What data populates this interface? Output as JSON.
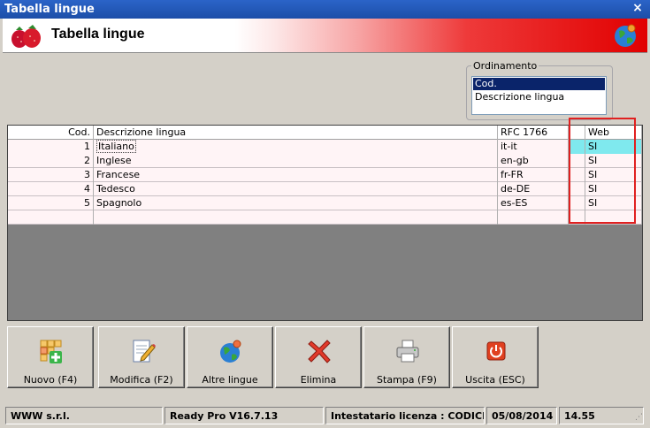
{
  "window": {
    "title": "Tabella lingue",
    "close_glyph": "×"
  },
  "header": {
    "title": "Tabella lingue",
    "logo_icon": "strawberry-icon",
    "globe_icon": "globe-icon"
  },
  "ordering": {
    "legend": "Ordinamento",
    "options": [
      "Cod.",
      "Descrizione lingua"
    ],
    "selected": "Cod."
  },
  "grid": {
    "columns": [
      "Cod.",
      "Descrizione lingua",
      "RFC 1766",
      "Web"
    ],
    "rows": [
      {
        "cod": "1",
        "desc": "Italiano",
        "rfc": "it-it",
        "web": "SI"
      },
      {
        "cod": "2",
        "desc": "Inglese",
        "rfc": "en-gb",
        "web": "SI"
      },
      {
        "cod": "3",
        "desc": "Francese",
        "rfc": "fr-FR",
        "web": "SI"
      },
      {
        "cod": "4",
        "desc": "Tedesco",
        "rfc": "de-DE",
        "web": "SI"
      },
      {
        "cod": "5",
        "desc": "Spagnolo",
        "rfc": "es-ES",
        "web": "SI"
      }
    ],
    "active_row_color": "#7fe9ee",
    "highlight_color": "#e02020"
  },
  "toolbar": {
    "buttons": [
      {
        "label": "Nuovo (F4)",
        "icon": "new-grid-icon"
      },
      {
        "label": "Modifica (F2)",
        "icon": "edit-document-icon"
      },
      {
        "label": "Altre lingue",
        "icon": "globe-icon"
      },
      {
        "label": "Elimina",
        "icon": "delete-x-icon"
      },
      {
        "label": "Stampa (F9)",
        "icon": "printer-icon"
      },
      {
        "label": "Uscita (ESC)",
        "icon": "exit-icon"
      }
    ]
  },
  "status": {
    "company": "WWW s.r.l.",
    "version": "Ready Pro V16.7.13",
    "license": "Intestatario licenza : CODICE SI",
    "date": "05/08/2014",
    "time": "14.55"
  }
}
